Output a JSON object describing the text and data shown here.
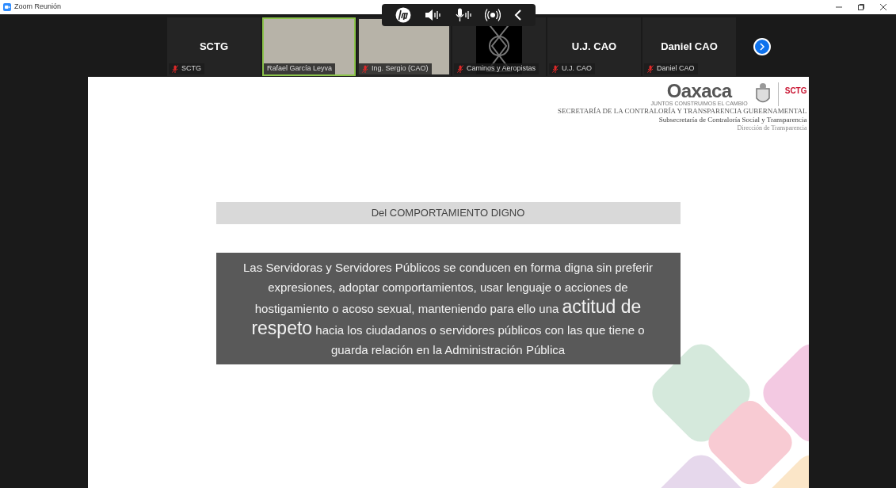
{
  "window": {
    "title": "Zoom Reunión"
  },
  "participants": [
    {
      "kind": "name",
      "display_name": "SCTG",
      "label": "SCTG",
      "muted": true,
      "speaking": false
    },
    {
      "kind": "video",
      "label": "Rafael García Leyva",
      "muted": false,
      "speaking": true
    },
    {
      "kind": "video",
      "label": "Ing. Sergio (CAO)",
      "muted": true,
      "speaking": false
    },
    {
      "kind": "logo",
      "label": "Caminos y Aeropistas",
      "muted": true,
      "speaking": false
    },
    {
      "kind": "name",
      "display_name": "U.J. CAO",
      "label": "U.J. CAO",
      "muted": true,
      "speaking": false
    },
    {
      "kind": "name",
      "display_name": "Daniel CAO",
      "label": "Daniel CAO",
      "muted": true,
      "speaking": false
    }
  ],
  "slide": {
    "logo": {
      "wordmark": "Oaxaca",
      "tagline": "JUNTOS CONSTRUIMOS EL CAMBIO",
      "badge": "SCTG"
    },
    "header_lines": [
      "SECRETARÍA DE LA CONTRALORÍA Y TRANSPARENCIA GUBERNAMENTAL",
      "Subsecretaría de Contraloría Social y Transparencia",
      "Dirección de Transparencia"
    ],
    "heading": "Del COMPORTAMIENTO DIGNO",
    "body": {
      "before": "Las Servidoras y Servidores Públicos se conducen en forma digna sin preferir expresiones, adoptar comportamientos, usar lenguaje o acciones de hostigamiento o acoso sexual, manteniendo para ello una ",
      "emphasis": "actitud de respeto",
      "after": " hacia los ciudadanos o servidores públicos con las que tiene o guarda relación en la Administración Pública"
    }
  }
}
